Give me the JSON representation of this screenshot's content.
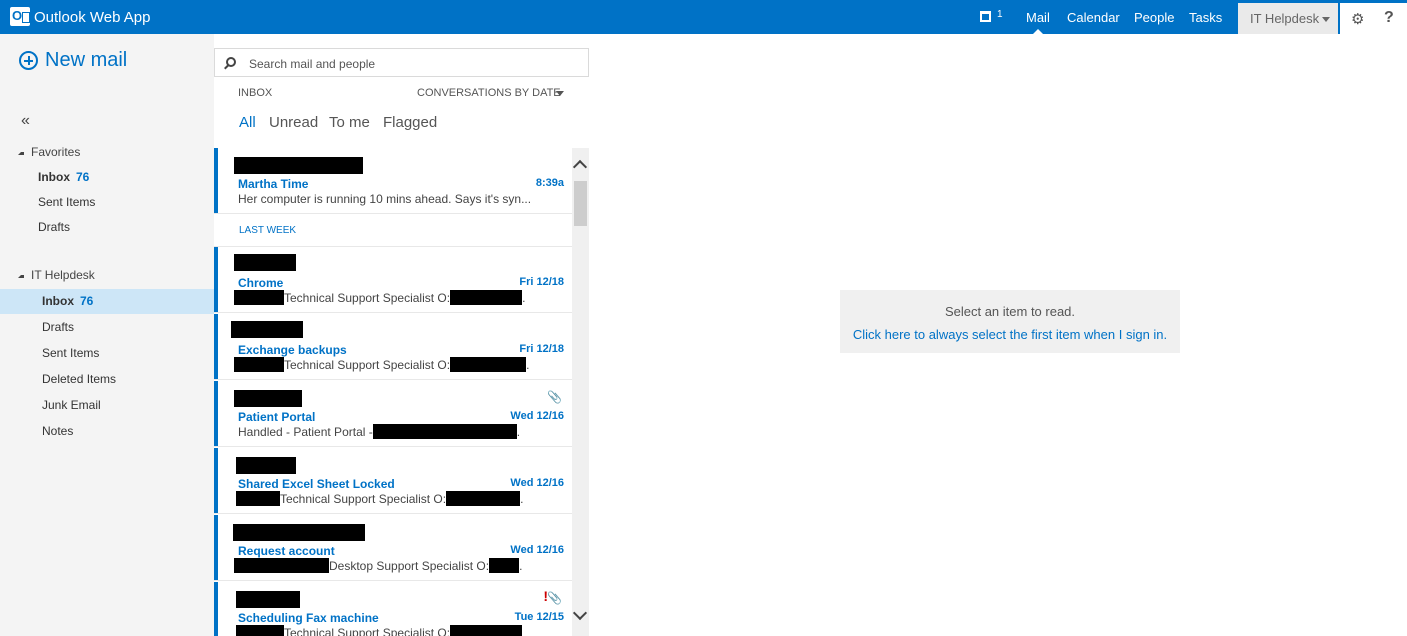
{
  "topbar": {
    "app_title": "Outlook Web App",
    "calendar_count": "1",
    "nav": [
      "Mail",
      "Calendar",
      "People",
      "Tasks"
    ],
    "active_nav": "Mail",
    "user": "IT Helpdesk",
    "settings_icon": "gear-icon",
    "help_label": "?"
  },
  "sidebar": {
    "new_mail": "New mail",
    "collapse_glyph": "«",
    "favorites": {
      "header": "Favorites",
      "items": [
        {
          "label": "Inbox",
          "count": "76"
        },
        {
          "label": "Sent Items"
        },
        {
          "label": "Drafts"
        }
      ]
    },
    "account": {
      "header": "IT Helpdesk",
      "items": [
        {
          "label": "Inbox",
          "count": "76"
        },
        {
          "label": "Drafts"
        },
        {
          "label": "Sent Items"
        },
        {
          "label": "Deleted Items"
        },
        {
          "label": "Junk Email"
        },
        {
          "label": "Notes"
        }
      ]
    }
  },
  "search": {
    "placeholder": "Search mail and people"
  },
  "list": {
    "folder_label": "INBOX",
    "sort_label": "CONVERSATIONS BY DATE",
    "filters": [
      "All",
      "Unread",
      "To me",
      "Flagged"
    ],
    "active_filter": "All",
    "group_last_week": "LAST WEEK",
    "messages": [
      {
        "subject": "Martha Time",
        "date": "8:39a",
        "preview": "Her computer is running 10 mins ahead. Says it's syn..."
      },
      {
        "subject": "Chrome",
        "date": "Fri 12/18",
        "preview_pre": "",
        "preview_mid": "Technical Support Specialist O:",
        "preview_end": "."
      },
      {
        "subject": "Exchange backups",
        "date": "Fri 12/18",
        "preview_mid": "Technical Support Specialist O:",
        "preview_end": "."
      },
      {
        "subject": "Patient Portal",
        "date": "Wed 12/16",
        "preview_mid": "Handled - Patient Portal -",
        "preview_end": ".",
        "attachment": true
      },
      {
        "subject": "Shared Excel Sheet Locked",
        "date": "Wed 12/16",
        "preview_mid": "Technical Support Specialist O:",
        "preview_end": "."
      },
      {
        "subject": "Request account",
        "date": "Wed 12/16",
        "preview_mid": "Desktop Support Specialist O:",
        "preview_end": "."
      },
      {
        "subject": "Scheduling Fax machine",
        "date": "Tue 12/15",
        "preview_mid": "Technical Support Specialist O:",
        "preview_end": "",
        "attachment": true,
        "important": "!"
      }
    ]
  },
  "reading_pane": {
    "message": "Select an item to read.",
    "link": "Click here to always select the first item when I sign in."
  },
  "colors": {
    "accent": "#0072c6",
    "selected": "#cde6f7",
    "sidebar_bg": "#f4f4f4"
  }
}
